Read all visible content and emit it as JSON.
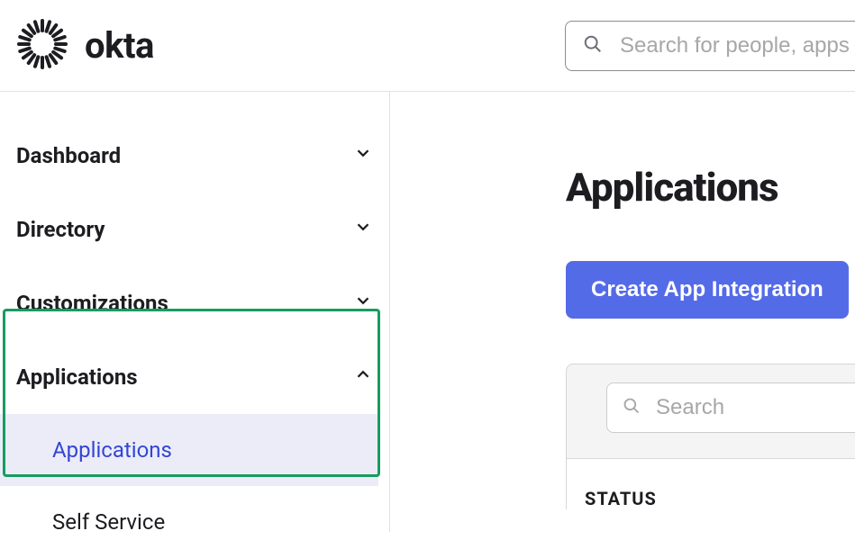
{
  "brand": "okta",
  "topsearch": {
    "placeholder": "Search for people, apps"
  },
  "sidebar": {
    "items": [
      {
        "label": "Dashboard",
        "expanded": false
      },
      {
        "label": "Directory",
        "expanded": false
      },
      {
        "label": "Customizations",
        "expanded": false
      },
      {
        "label": "Applications",
        "expanded": true
      }
    ],
    "applications_sub": [
      {
        "label": "Applications",
        "active": true
      },
      {
        "label": "Self Service",
        "active": false
      }
    ]
  },
  "main": {
    "title": "Applications",
    "create_label": "Create App Integration",
    "panel_search_placeholder": "Search",
    "status_header": "STATUS"
  }
}
